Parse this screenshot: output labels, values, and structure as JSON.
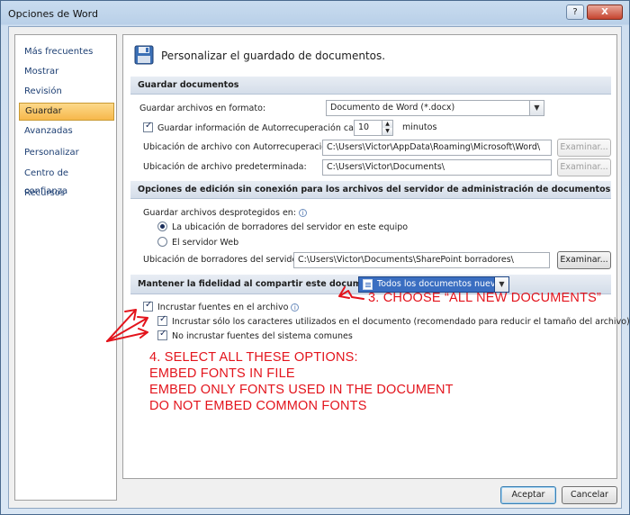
{
  "window": {
    "title": "Opciones de Word",
    "help_glyph": "?",
    "close_glyph": "X"
  },
  "sidebar": {
    "items": [
      {
        "label": "Más frecuentes"
      },
      {
        "label": "Mostrar"
      },
      {
        "label": "Revisión"
      },
      {
        "label": "Guardar",
        "active": true
      },
      {
        "label": "Avanzadas"
      },
      {
        "label": "Personalizar"
      },
      {
        "label": "Centro de confianza"
      },
      {
        "label": "Recursos"
      }
    ]
  },
  "main": {
    "heading": "Personalizar el guardado de documentos.",
    "header_icon": "floppy-disk-icon",
    "save_section": {
      "title": "Guardar documentos",
      "format_label": "Guardar archivos en formato:",
      "format_value": "Documento de Word (*.docx)",
      "autorecover_label": "Guardar información de Autorrecuperación cada",
      "autorecover_checked": true,
      "autorecover_minutes": "10",
      "minutes_label": "minutos",
      "autorecover_location_label": "Ubicación de archivo con Autorrecuperación:",
      "autorecover_location_value": "C:\\Users\\Victor\\AppData\\Roaming\\Microsoft\\Word\\",
      "default_location_label": "Ubicación de archivo predeterminada:",
      "default_location_value": "C:\\Users\\Victor\\Documents\\",
      "browse_label": "Examinar..."
    },
    "offline_section": {
      "title": "Opciones de edición sin conexión para los archivos del servidor de administración de documentos",
      "save_checked_out_label": "Guardar archivos desprotegidos en:",
      "option_server_drafts": "La ubicación de borradores del servidor en este equipo",
      "option_web_server": "El servidor Web",
      "selected_option": "server_drafts",
      "drafts_location_label": "Ubicación de borradores del servidor:",
      "drafts_location_value": "C:\\Users\\Victor\\Documents\\SharePoint borradores\\",
      "browse_label": "Examinar..."
    },
    "fidelity_section": {
      "title": "Mantener la fidelidad al compartir este documento:",
      "document_value": "Todos los documentos nuevos",
      "embed_fonts_label": "Incrustar fuentes en el archivo",
      "embed_fonts_checked": true,
      "embed_used_chars_label": "Incrustar sólo los caracteres utilizados en el documento (recomendado para reducir el tamaño del archivo)",
      "embed_used_chars_checked": true,
      "no_common_fonts_label": "No incrustar fuentes del sistema comunes",
      "no_common_fonts_checked": true
    }
  },
  "footer": {
    "ok_label": "Aceptar",
    "cancel_label": "Cancelar"
  },
  "annotations": {
    "color": "#e3141c",
    "step3": "3. CHOOSE “ALL NEW DOCUMENTS”",
    "step4_lines": [
      "4. SELECT ALL THESE OPTIONS:",
      "EMBED FONTS IN FILE",
      "EMBED ONLY FONTS USED IN THE DOCUMENT",
      "DO NOT EMBED COMMON FONTS"
    ]
  }
}
